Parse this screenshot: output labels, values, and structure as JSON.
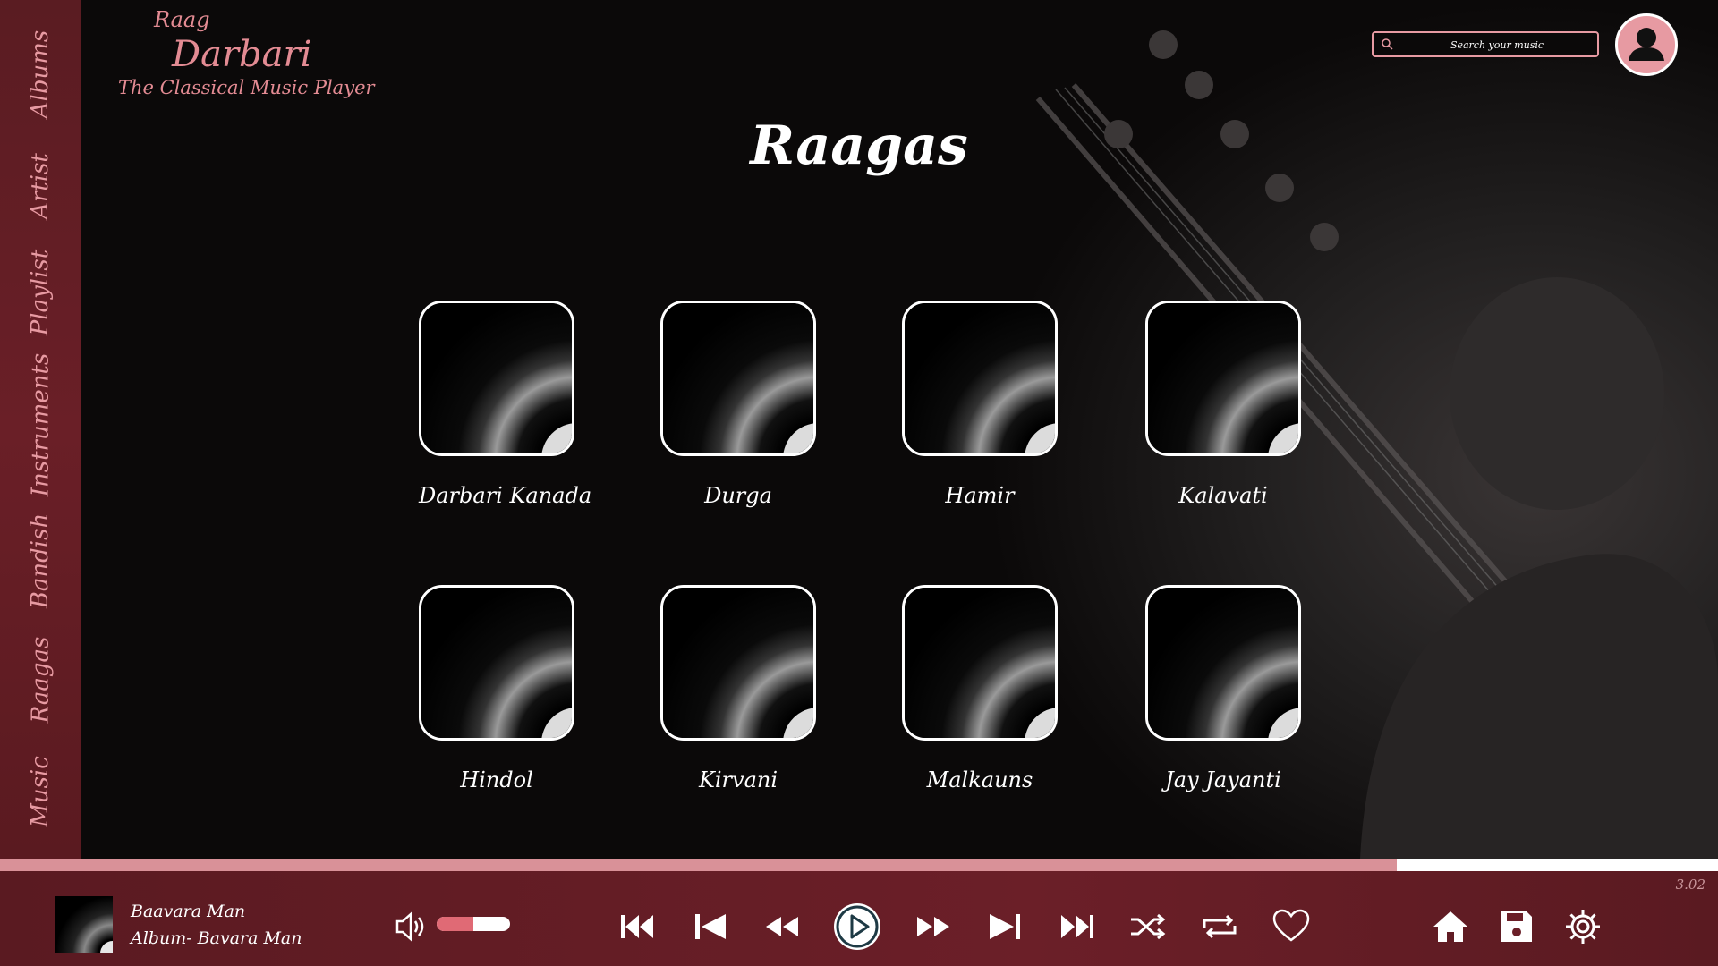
{
  "brand": {
    "line1": "Raag",
    "line2": "Darbari",
    "tagline": "The Classical Music Player"
  },
  "search": {
    "placeholder": "Search your music"
  },
  "sidebar": {
    "items": [
      {
        "label": "Albums"
      },
      {
        "label": "Artist"
      },
      {
        "label": "Playlist"
      },
      {
        "label": "Instruments"
      },
      {
        "label": "Bandish"
      },
      {
        "label": "Raagas"
      },
      {
        "label": "Music"
      }
    ]
  },
  "main": {
    "title": "Raagas",
    "raagas": [
      {
        "name": "Darbari Kanada"
      },
      {
        "name": "Durga"
      },
      {
        "name": "Hamir"
      },
      {
        "name": "Kalavati"
      },
      {
        "name": "Hindol"
      },
      {
        "name": "Kirvani"
      },
      {
        "name": "Malkauns"
      },
      {
        "name": "Jay Jayanti"
      }
    ]
  },
  "player": {
    "track_title": "Baavara Man",
    "album_line": "Album- Bavara Man",
    "time": "3.02",
    "progress": 0.813,
    "volume": 0.5,
    "controls": [
      "volume-icon",
      "skip-start-icon",
      "previous-icon",
      "rewind-icon",
      "play-icon",
      "fast-forward-icon",
      "next-icon",
      "skip-end-icon",
      "shuffle-icon",
      "repeat-icon",
      "heart-icon",
      "home-icon",
      "save-icon",
      "settings-icon"
    ]
  },
  "colors": {
    "accent": "#e79aa2",
    "sidebar": "#6a1f27",
    "player": "#6b1f28",
    "progress": "#d99198",
    "volume": "#e06a75"
  }
}
